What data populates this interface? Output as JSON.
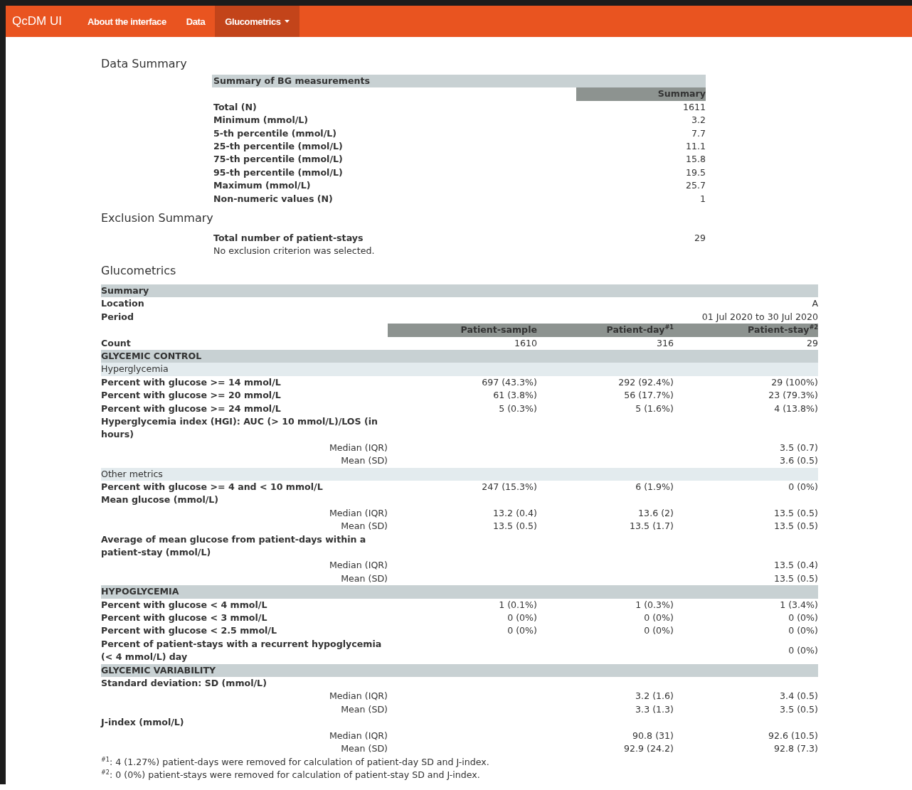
{
  "navbar": {
    "brand": "QcDM UI",
    "items": [
      {
        "label": "About the interface",
        "selected": false,
        "dropdown": false
      },
      {
        "label": "Data",
        "selected": false,
        "dropdown": false
      },
      {
        "label": "Glucometrics",
        "selected": true,
        "dropdown": true
      }
    ]
  },
  "data_summary": {
    "heading": "Data Summary",
    "title": "Summary of BG measurements",
    "column": "Summary",
    "rows": [
      {
        "label": "Total (N)",
        "value": "1611"
      },
      {
        "label": "Minimum (mmol/L)",
        "value": "3.2"
      },
      {
        "label": "5-th percentile (mmol/L)",
        "value": "7.7"
      },
      {
        "label": "25-th percentile (mmol/L)",
        "value": "11.1"
      },
      {
        "label": "75-th percentile (mmol/L)",
        "value": "15.8"
      },
      {
        "label": "95-th percentile (mmol/L)",
        "value": "19.5"
      },
      {
        "label": "Maximum (mmol/L)",
        "value": "25.7"
      },
      {
        "label": "Non-numeric values (N)",
        "value": "1"
      }
    ]
  },
  "exclusion_summary": {
    "heading": "Exclusion Summary",
    "label": "Total number of patient-stays",
    "value": "29",
    "note": "No exclusion criterion was selected."
  },
  "glucometrics": {
    "heading": "Glucometrics",
    "rows": [
      {
        "kind": "band",
        "label": "Summary"
      },
      {
        "kind": "info",
        "label": "Location",
        "value": "A"
      },
      {
        "kind": "info",
        "label": "Period",
        "value": "01 Jul 2020 to 30 Jul 2020"
      },
      {
        "kind": "colheads",
        "values": {
          "patient_sample": "Patient-sample",
          "patient_day": "Patient-day$^{#1}$",
          "patient_stay": "Patient-stay$^{#2}$"
        }
      },
      {
        "kind": "row",
        "label": "Count",
        "values": {
          "patient_sample": "1610",
          "patient_day": "316",
          "patient_stay": "29"
        }
      },
      {
        "kind": "band",
        "label": "GLYCEMIC CONTROL"
      },
      {
        "kind": "subband",
        "label": "Hyperglycemia"
      },
      {
        "kind": "row",
        "label": "Percent with glucose >= 14 mmol/L",
        "values": {
          "patient_sample": "697 (43.3%)",
          "patient_day": "292 (92.4%)",
          "patient_stay": "29 (100%)"
        }
      },
      {
        "kind": "row",
        "label": "Percent with glucose >= 20 mmol/L",
        "values": {
          "patient_sample": "61 (3.8%)",
          "patient_day": "56 (17.7%)",
          "patient_stay": "23 (79.3%)"
        }
      },
      {
        "kind": "row",
        "label": "Percent with glucose >= 24 mmol/L",
        "values": {
          "patient_sample": "5 (0.3%)",
          "patient_day": "5 (1.6%)",
          "patient_stay": "4 (13.8%)"
        }
      },
      {
        "kind": "row",
        "label": "Hyperglycemia index (HGI): AUC (> 10 mmol/L)/LOS (in hours)",
        "values": {}
      },
      {
        "kind": "stat",
        "label": "Median (IQR)",
        "values": {
          "patient_stay": "3.5 (0.7)"
        }
      },
      {
        "kind": "stat",
        "label": "Mean (SD)",
        "values": {
          "patient_stay": "3.6 (0.5)"
        }
      },
      {
        "kind": "subband",
        "label": "Other metrics"
      },
      {
        "kind": "row",
        "label": "Percent with glucose >= 4 and < 10 mmol/L",
        "values": {
          "patient_sample": "247 (15.3%)",
          "patient_day": "6 (1.9%)",
          "patient_stay": "0 (0%)"
        }
      },
      {
        "kind": "row",
        "label": "Mean glucose (mmol/L)",
        "values": {}
      },
      {
        "kind": "stat",
        "label": "Median (IQR)",
        "values": {
          "patient_sample": "13.2 (0.4)",
          "patient_day": "13.6 (2)",
          "patient_stay": "13.5 (0.5)"
        }
      },
      {
        "kind": "stat",
        "label": "Mean (SD)",
        "values": {
          "patient_sample": "13.5 (0.5)",
          "patient_day": "13.5 (1.7)",
          "patient_stay": "13.5 (0.5)"
        }
      },
      {
        "kind": "row",
        "label": "Average of mean glucose from patient-days within a patient-stay (mmol/L)",
        "values": {}
      },
      {
        "kind": "stat",
        "label": "Median (IQR)",
        "values": {
          "patient_stay": "13.5 (0.4)"
        }
      },
      {
        "kind": "stat",
        "label": "Mean (SD)",
        "values": {
          "patient_stay": "13.5 (0.5)"
        }
      },
      {
        "kind": "band",
        "label": "HYPOGLYCEMIA"
      },
      {
        "kind": "row",
        "label": "Percent with glucose < 4 mmol/L",
        "values": {
          "patient_sample": "1 (0.1%)",
          "patient_day": "1 (0.3%)",
          "patient_stay": "1 (3.4%)"
        }
      },
      {
        "kind": "row",
        "label": "Percent with glucose < 3 mmol/L",
        "values": {
          "patient_sample": "0 (0%)",
          "patient_day": "0 (0%)",
          "patient_stay": "0 (0%)"
        }
      },
      {
        "kind": "row",
        "label": "Percent with glucose < 2.5 mmol/L",
        "values": {
          "patient_sample": "0 (0%)",
          "patient_day": "0 (0%)",
          "patient_stay": "0 (0%)"
        }
      },
      {
        "kind": "row",
        "label": "Percent of patient-stays with a recurrent hypoglycemia (< 4 mmol/L) day",
        "values": {
          "patient_stay": "0 (0%)"
        }
      },
      {
        "kind": "band",
        "label": "GLYCEMIC VARIABILITY"
      },
      {
        "kind": "row",
        "label": "Standard deviation: SD (mmol/L)",
        "values": {}
      },
      {
        "kind": "stat",
        "label": "Median (IQR)",
        "values": {
          "patient_day": "3.2 (1.6)",
          "patient_stay": "3.4 (0.5)"
        }
      },
      {
        "kind": "stat",
        "label": "Mean (SD)",
        "values": {
          "patient_day": "3.3 (1.3)",
          "patient_stay": "3.5 (0.5)"
        }
      },
      {
        "kind": "row",
        "label": "J-index (mmol/L)",
        "values": {}
      },
      {
        "kind": "stat",
        "label": "Median (IQR)",
        "values": {
          "patient_day": "90.8 (31)",
          "patient_stay": "92.6 (10.5)"
        }
      },
      {
        "kind": "stat",
        "label": "Mean (SD)",
        "values": {
          "patient_day": "92.9 (24.2)",
          "patient_stay": "92.8 (7.3)"
        }
      }
    ],
    "footnotes": [
      "$^{#1}$: 4 (1.27%) patient-days were removed for calculation of patient-day SD and J-index.",
      "$^{#2}$: 0 (0%) patient-stays were removed for calculation of patient-stay SD and J-index."
    ]
  }
}
